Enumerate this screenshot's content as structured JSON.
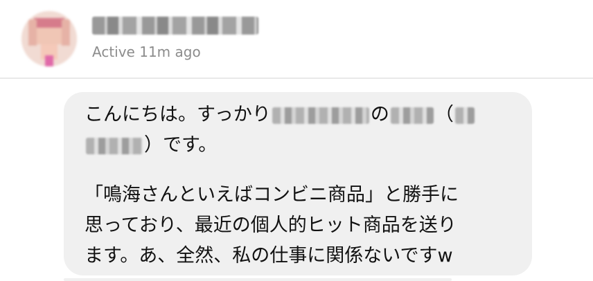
{
  "contact": {
    "status": "Active 11m ago"
  },
  "message": {
    "line1_a": "こんにちは。すっかり",
    "line1_b": "の",
    "line1_c": "（",
    "line2_a": "）です。",
    "line4": "「鳴海さんといえばコンビニ商品」と勝手に",
    "line5": "思っており、最近の個人的ヒット商品を送り",
    "line6": "ます。あ、全然、私の仕事に関係ないですw"
  }
}
